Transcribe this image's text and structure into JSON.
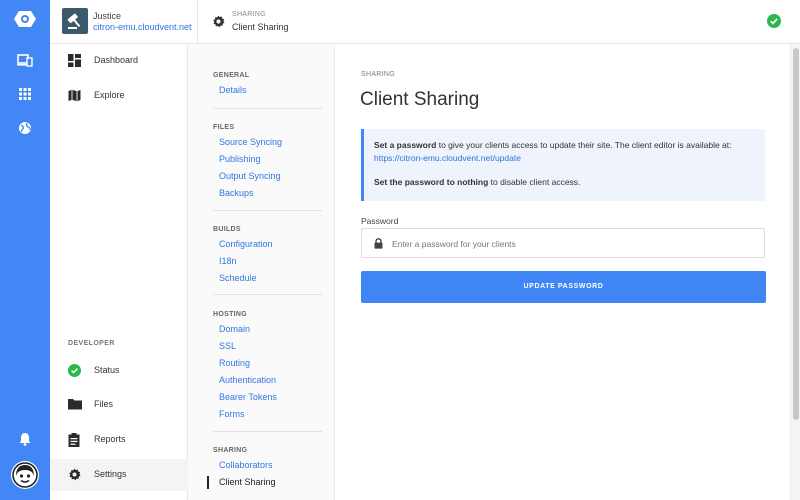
{
  "colors": {
    "brand_blue": "#4287f5",
    "link_blue": "#2d73e0",
    "success_green": "#2eb84b"
  },
  "rail": {
    "icons": [
      "cloud-logo-icon",
      "devices-icon",
      "apps-grid-icon",
      "globe-icon",
      "bell-icon",
      "user-avatar-icon"
    ]
  },
  "header": {
    "site_name": "Justice",
    "site_url": "citron-emu.cloudvent.net",
    "breadcrumb_section": "SHARING",
    "breadcrumb_title": "Client Sharing",
    "status_icon": "check-circle-icon"
  },
  "nav": {
    "items": [
      {
        "label": "Dashboard",
        "icon": "dashboard-icon"
      },
      {
        "label": "Explore",
        "icon": "map-icon"
      }
    ],
    "developer_heading": "DEVELOPER",
    "developer_items": [
      {
        "label": "Status",
        "icon": "check-circle-icon"
      },
      {
        "label": "Files",
        "icon": "folder-icon"
      },
      {
        "label": "Reports",
        "icon": "clipboard-icon"
      },
      {
        "label": "Settings",
        "icon": "gear-icon"
      }
    ]
  },
  "subnav": {
    "general": {
      "heading": "GENERAL",
      "links": [
        "Details"
      ]
    },
    "files": {
      "heading": "FILES",
      "links": [
        "Source Syncing",
        "Publishing",
        "Output Syncing",
        "Backups"
      ]
    },
    "builds": {
      "heading": "BUILDS",
      "links": [
        "Configuration",
        "I18n",
        "Schedule"
      ]
    },
    "hosting": {
      "heading": "HOSTING",
      "links": [
        "Domain",
        "SSL",
        "Routing",
        "Authentication",
        "Bearer Tokens",
        "Forms"
      ]
    },
    "sharing": {
      "heading": "SHARING",
      "links": [
        "Collaborators",
        "Client Sharing"
      ]
    }
  },
  "main": {
    "pre_title": "SHARING",
    "title": "Client Sharing",
    "info_bold_1": "Set a password",
    "info_text_1": " to give your clients access to update their site. The client editor is available at:",
    "info_link": "https://citron-emu.cloudvent.net/update",
    "info_bold_2": "Set the password to nothing",
    "info_text_2": " to disable client access.",
    "password_label": "Password",
    "password_placeholder": "Enter a password for your clients",
    "password_value": "",
    "update_button": "UPDATE PASSWORD"
  }
}
